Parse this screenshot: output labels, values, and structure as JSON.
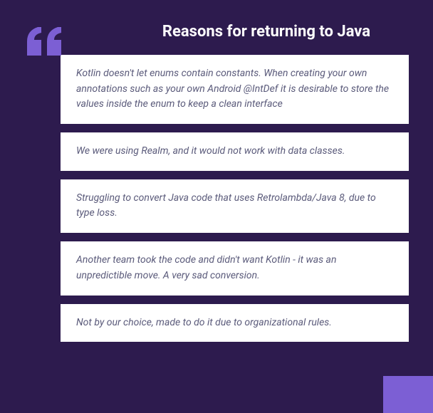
{
  "title": "Reasons for returning to Java",
  "quotes": [
    "Kotlin doesn't let enums contain constants. When creating your own annotations such as your own Android @IntDef it is desirable to store the values inside the enum to keep a clean interface",
    "We were using Realm, and it would not work with data classes.",
    "Struggling to convert Java code that uses Retrolambda/Java 8, due to type loss.",
    "Another team took the code and didn't want Kotlin - it was an unpredictible move. A very sad conversion.",
    "Not by our choice, made to do it due to organizational rules."
  ]
}
